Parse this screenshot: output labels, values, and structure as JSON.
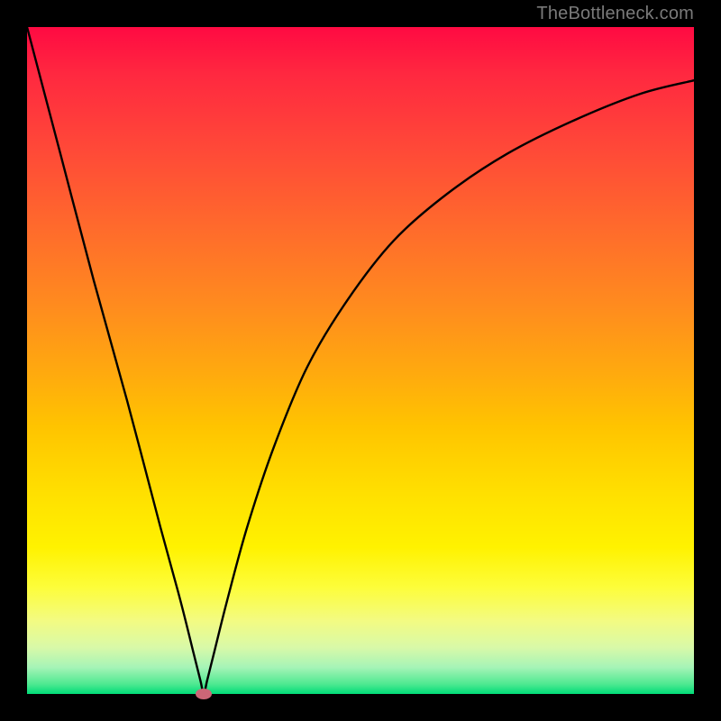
{
  "watermark": "TheBottleneck.com",
  "chart_data": {
    "type": "line",
    "title": "",
    "xlabel": "",
    "ylabel": "",
    "xlim": [
      0,
      100
    ],
    "ylim": [
      0,
      100
    ],
    "grid": false,
    "legend": false,
    "background_gradient": {
      "stops": [
        {
          "pos": 0,
          "color": "#ff0a42"
        },
        {
          "pos": 50,
          "color": "#ffaa0e"
        },
        {
          "pos": 80,
          "color": "#fff200"
        },
        {
          "pos": 100,
          "color": "#00dc78"
        }
      ]
    },
    "series": [
      {
        "name": "bottleneck-curve",
        "x": [
          0,
          5,
          10,
          15,
          20,
          23,
          25,
          26,
          26.5,
          27,
          28,
          30,
          33,
          37,
          42,
          48,
          55,
          63,
          72,
          82,
          92,
          100
        ],
        "y": [
          100,
          81,
          62,
          44,
          25,
          14,
          6,
          2,
          0,
          2,
          6,
          14,
          25,
          37,
          49,
          59,
          68,
          75,
          81,
          86,
          90,
          92
        ]
      }
    ],
    "markers": [
      {
        "name": "optimum-point",
        "x": 26.5,
        "y": 0,
        "color": "#cc6677"
      }
    ]
  }
}
